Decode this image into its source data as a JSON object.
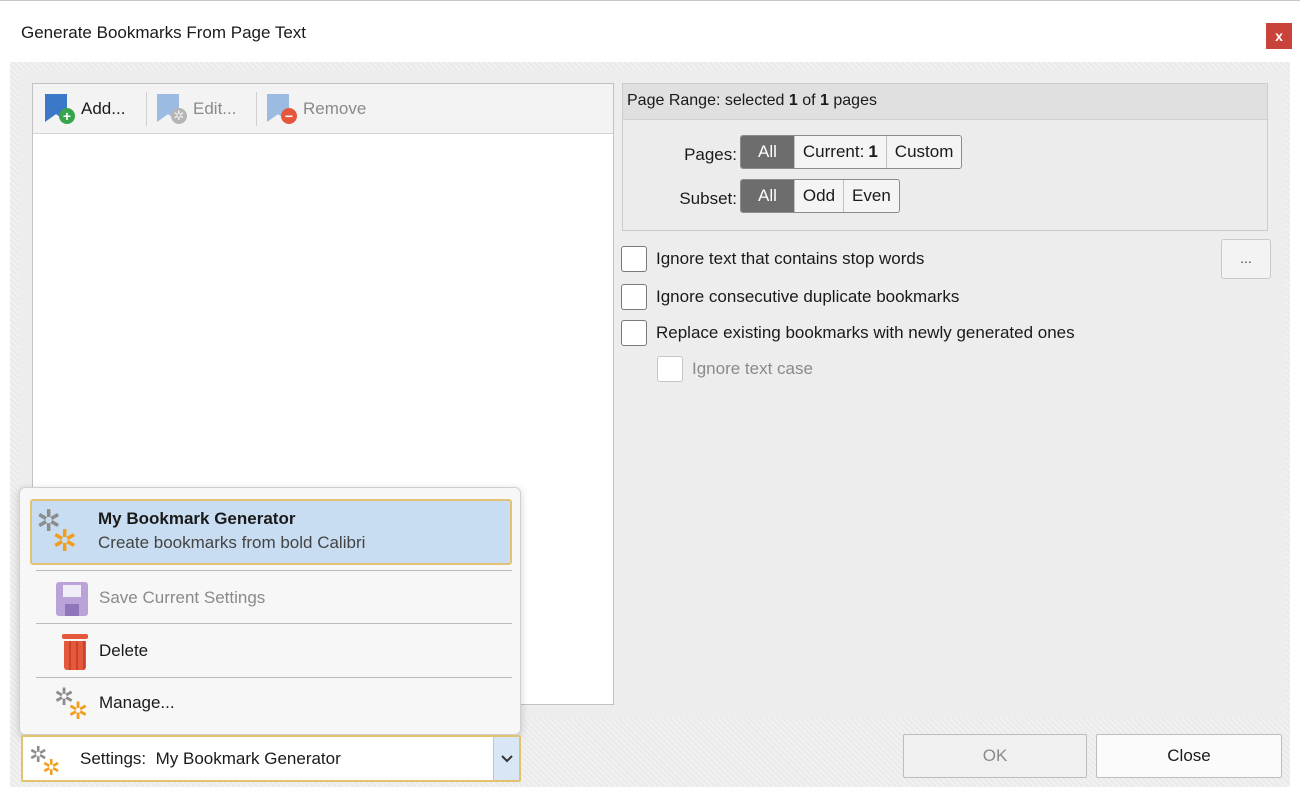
{
  "window": {
    "title": "Generate Bookmarks From Page Text",
    "close_glyph": "x"
  },
  "toolbar": {
    "add_label": "Add...",
    "edit_label": "Edit...",
    "remove_label": "Remove"
  },
  "page_range": {
    "header_prefix": "Page Range: selected ",
    "selected": "1",
    "of_text": " of ",
    "total": "1",
    "suffix": " pages",
    "pages_label": "Pages:",
    "pages_options": {
      "all": "All",
      "current_prefix": "Current: ",
      "current_value": "1",
      "custom": "Custom"
    },
    "pages_selected": "All",
    "subset_label": "Subset:",
    "subset_options": {
      "all": "All",
      "odd": "Odd",
      "even": "Even"
    },
    "subset_selected": "All"
  },
  "options": {
    "ignore_stop_words": "Ignore text that contains stop words",
    "ignore_duplicates": "Ignore consecutive duplicate bookmarks",
    "replace_existing": "Replace existing bookmarks with newly generated ones",
    "ignore_case": "Ignore text case",
    "stop_words_button": "..."
  },
  "settings_menu": {
    "items": [
      {
        "title": "My Bookmark Generator",
        "subtitle": "Create bookmarks from bold Calibri"
      }
    ],
    "save_label": "Save Current Settings",
    "delete_label": "Delete",
    "manage_label": "Manage..."
  },
  "footer": {
    "settings_value": "Settings:  My Bookmark Generator",
    "ok_label": "OK",
    "close_label": "Close"
  },
  "colors": {
    "accent_blue": "#3b78c8",
    "close_red": "#c9433a",
    "selection_blue": "#c8ddf1",
    "selection_border": "#e0c374",
    "segment_selected": "#6d6d6d"
  },
  "icons": [
    "add-bookmark-icon",
    "edit-bookmark-icon",
    "remove-bookmark-icon",
    "gear-icon",
    "save-icon",
    "trash-icon",
    "chevron-down-icon"
  ]
}
